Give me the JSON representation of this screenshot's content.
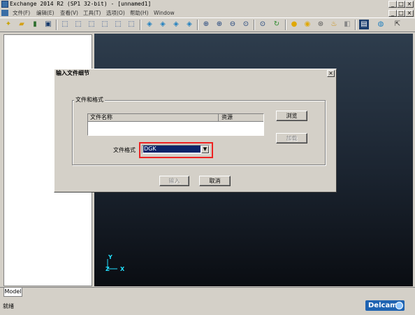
{
  "window": {
    "title": "Exchange 2014 R2 (SP1 32-bit) - [unnamed1]",
    "minimize_glyph": "_",
    "maximize_glyph": "□",
    "close_glyph": "×",
    "inner_minimize_glyph": "_",
    "inner_restore_glyph": "□",
    "inner_close_glyph": "×"
  },
  "menubar": {
    "items": [
      {
        "label": "文件(F)"
      },
      {
        "label": "编辑(E)"
      },
      {
        "label": "查看(V)"
      },
      {
        "label": "工具(T)"
      },
      {
        "label": "选项(O)"
      },
      {
        "label": "帮助(H)"
      },
      {
        "label": "Window"
      }
    ]
  },
  "toolbar": {
    "icons": [
      "new-icon",
      "open-icon",
      "import-icon",
      "save-icon",
      "iso-view-1-icon",
      "iso-view-2-icon",
      "iso-view-3-icon",
      "iso-view-4-icon",
      "iso-view-5-icon",
      "iso-view-6-icon",
      "view-front-icon",
      "view-back-icon",
      "view-top-icon",
      "view-side-icon",
      "zoom-window-icon",
      "zoom-in-icon",
      "zoom-out-icon",
      "zoom-fit-icon",
      "zoom-selection-icon",
      "refresh-icon",
      "shade-icon",
      "shade-edges-icon",
      "wireframe-icon",
      "lights-icon",
      "display-mode-icon",
      "help-icon",
      "pointer-help-icon"
    ]
  },
  "viewport": {
    "axis_y": "Y",
    "axis_z": "Z",
    "axis_x": "X"
  },
  "tabs": {
    "model": "Model"
  },
  "status": {
    "text": "就绪",
    "brand": "Delcam"
  },
  "dialog": {
    "title": "输入文件细节",
    "group_label": "文件和格式",
    "columns": [
      "文件名称",
      "资源"
    ],
    "browse_button": "浏览",
    "secondary_button": "加载",
    "format_label": "文件格式",
    "format_value": "DGK",
    "ok_button": "输入",
    "cancel_button": "取消",
    "close_glyph": "×"
  }
}
